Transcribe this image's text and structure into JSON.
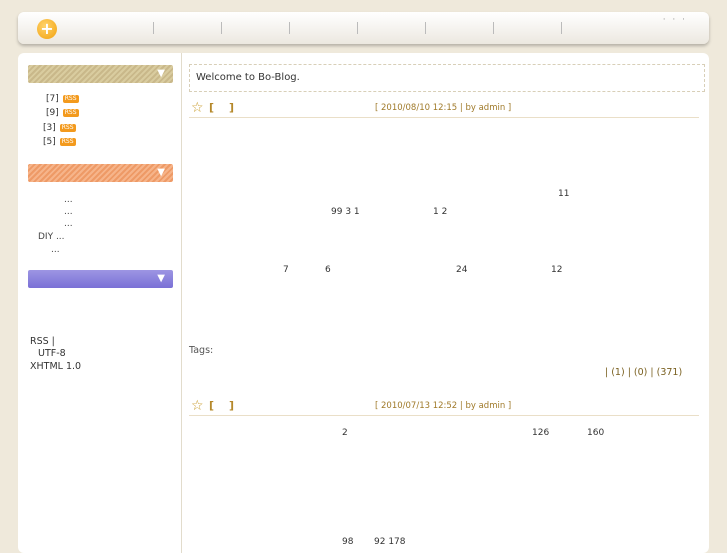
{
  "header": {
    "logo_glyph": "+",
    "dots": "· · ·"
  },
  "sidebar": {
    "section_arrow": "▼",
    "feeds": [
      {
        "count": "[7]",
        "badge": "RSS"
      },
      {
        "count": "[9]",
        "badge": "RSS"
      },
      {
        "count": "[3]",
        "badge": "RSS"
      },
      {
        "count": "[5]",
        "badge": "RSS"
      }
    ],
    "links": [
      "...",
      "...",
      "...",
      "DIY  ...",
      "..."
    ],
    "footer": {
      "line1": "RSS    |",
      "line2": "UTF-8",
      "line3": "XHTML 1.0"
    }
  },
  "content": {
    "welcome": "Welcome to Bo-Blog.",
    "post1": {
      "bracket_open": "[",
      "bracket_close": "]",
      "meta": "[ 2010/08/10 12:15 | by admin ]",
      "numbers": [
        "11",
        "99 3 1",
        "1  2",
        "7",
        "6",
        "24",
        "12"
      ],
      "tags_label": "Tags:",
      "stats": "|  (1) |   (0) |   (371)"
    },
    "post2": {
      "bracket_open": "[",
      "bracket_close": "]",
      "meta": "[ 2010/07/13 12:52 | by admin ]",
      "numbers": [
        "2",
        "126",
        "160",
        "98",
        "92 178"
      ]
    }
  },
  "colors": {
    "background": "#efe9db",
    "accent": "#b5882a",
    "rss": "#f39a1d",
    "sidebar_head_1": "#c9b88a",
    "sidebar_head_2": "#ee9a66",
    "sidebar_head_3": "#7a70d6"
  }
}
